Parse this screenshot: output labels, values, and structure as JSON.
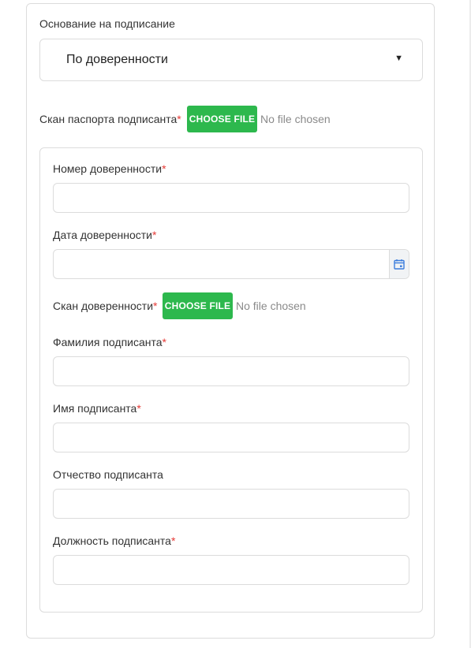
{
  "basis": {
    "label": "Основание на подписание",
    "selected": "По доверенности"
  },
  "passport_scan": {
    "label": "Скан паспорта подписанта",
    "button": "CHOOSE FILE",
    "status": "No file chosen"
  },
  "poa_section": {
    "number_label": "Номер доверенности",
    "date_label": "Дата доверенности",
    "scan_label": "Скан доверенности",
    "scan_button": "CHOOSE FILE",
    "scan_status": "No file chosen",
    "surname_label": "Фамилия подписанта",
    "name_label": "Имя подписанта",
    "patronymic_label": "Отчество подписанта",
    "position_label": "Должность подписанта"
  },
  "required_mark": "*",
  "colors": {
    "accent_green": "#2db84d",
    "required_red": "#e53935",
    "border": "#dcdcdc",
    "calendar_icon": "#3b7ddd"
  },
  "icons": {
    "select": "triangle-down-icon",
    "date": "calendar-icon"
  }
}
